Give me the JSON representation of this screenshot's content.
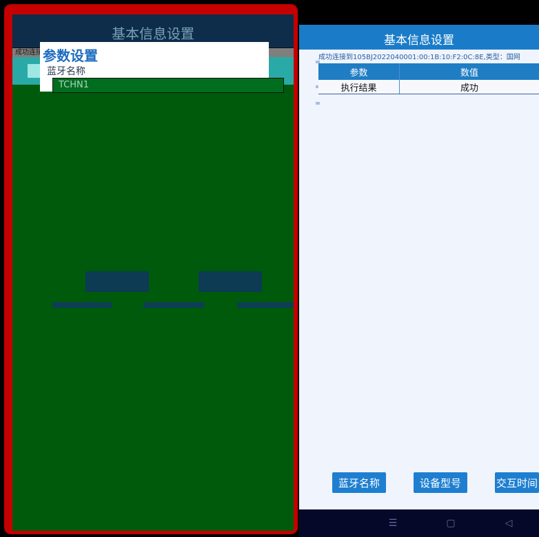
{
  "left_dialog": {
    "header_title": "基本信息设置",
    "status_text": "成功连接",
    "dialog_title": "参数设置",
    "field_label": "蓝牙名称",
    "field_value": "TCHN1"
  },
  "right_app": {
    "header_title": "基本信息设置",
    "status_line": "成功连接到105BJ2022040001:00:1B:10:F2:0C:8E,类型：国网",
    "table": {
      "headers": [
        "参数",
        "数值"
      ],
      "rows": [
        {
          "param": "执行结果",
          "value": "成功"
        }
      ]
    },
    "buttons": [
      {
        "label": "蓝牙名称"
      },
      {
        "label": "设备型号"
      },
      {
        "label": "交互时间"
      }
    ]
  },
  "nav_bar": {
    "menu_icon": "menu-icon",
    "home_icon": "home-icon",
    "back_icon": "back-icon"
  },
  "colors": {
    "highlight_border": "#c40000",
    "dialog_green": "#005a0c",
    "primary_blue": "#1a7cc8",
    "nav_bg": "#06082a"
  }
}
